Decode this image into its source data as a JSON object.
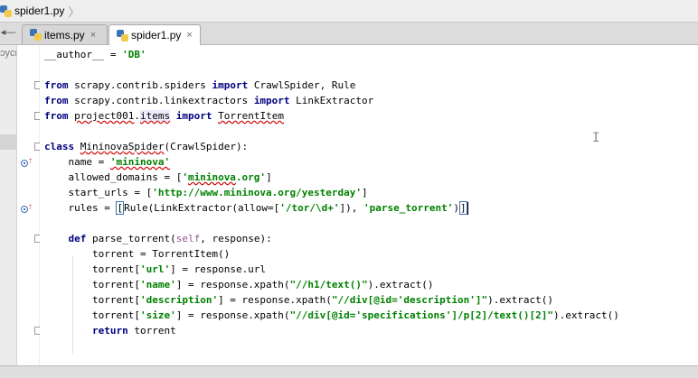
{
  "breadcrumb": {
    "file": "spider1.py",
    "separator": "〉"
  },
  "tabs": [
    {
      "label": "items.py",
      "close": "×",
      "active": false
    },
    {
      "label": "spider1.py",
      "close": "×",
      "active": true
    }
  ],
  "tabbar": {
    "nav_icon": "◂—"
  },
  "left_panel": {
    "clipped_text": "ɔycr"
  },
  "icons": {
    "python_file": "python-file-icon",
    "override_marker": "override-method-icon",
    "fold": "fold-marker-icon"
  },
  "code": {
    "l1": [
      "__author__ = ",
      "'DB'"
    ],
    "l3": [
      "from",
      " scrapy.contrib.spiders ",
      "import",
      " CrawlSpider, Rule"
    ],
    "l4": [
      "from",
      " scrapy.contrib.linkextractors ",
      "import",
      " LinkExtractor"
    ],
    "l5": [
      "from",
      " ",
      "project001",
      ".",
      "items",
      " ",
      "import",
      " ",
      "TorrentItem"
    ],
    "l7": [
      "class",
      " ",
      "MininovaSpider",
      "(CrawlSpider):"
    ],
    "l8": [
      "    name = ",
      "'mininova'"
    ],
    "l9": [
      "    allowed_domains = [",
      "'",
      "mininova",
      ".org'",
      "]"
    ],
    "l10": [
      "    start_urls = [",
      "'http://www.mininova.org/yesterday'",
      "]"
    ],
    "l11": [
      "    rules = ",
      "[",
      "Rule(LinkExtractor(allow=[",
      "'/tor/\\d+'",
      "]), ",
      "'parse_torrent'",
      ")",
      "]"
    ],
    "l13": [
      "    ",
      "def",
      " parse_torrent(",
      "self",
      ", response):"
    ],
    "l14": [
      "        torrent = TorrentItem()"
    ],
    "l15": [
      "        torrent[",
      "'url'",
      "] = response.url"
    ],
    "l16": [
      "        torrent[",
      "'name'",
      "] = response.xpath(",
      "\"//h1/text()\"",
      ").extract()"
    ],
    "l17": [
      "        torrent[",
      "'description'",
      "] = response.xpath(",
      "\"//div[@id='description']\"",
      ").extract()"
    ],
    "l18": [
      "        torrent[",
      "'size'",
      "] = response.xpath(",
      "\"//div[@id='specifications']/p[2]/text()[2]\"",
      ").extract()"
    ],
    "l19": [
      "        ",
      "return",
      " torrent"
    ]
  },
  "colors": {
    "keyword": "#000080",
    "string": "#008000",
    "self": "#94558d",
    "highlight_row": "#ffffd7",
    "error_squiggle": "#d00000"
  }
}
